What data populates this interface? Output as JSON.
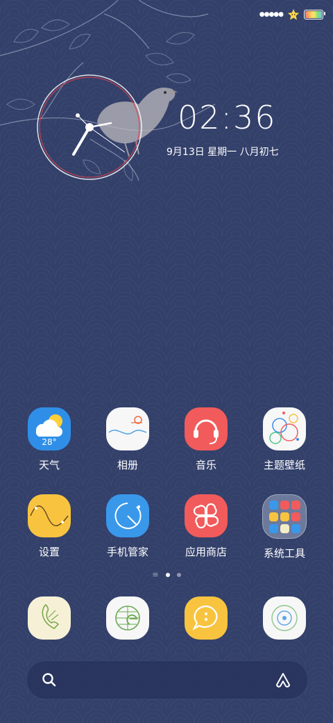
{
  "status_bar": {
    "signal_icon": "signal-dots-icon",
    "star_icon": "star-face-icon",
    "battery_icon": "battery-icon"
  },
  "clock": {
    "time": "02:36",
    "date": "9月13日 星期一 八月初七"
  },
  "apps_row1": [
    {
      "label": "天气",
      "icon": "weather-icon",
      "temp": "28°"
    },
    {
      "label": "相册",
      "icon": "gallery-icon"
    },
    {
      "label": "音乐",
      "icon": "music-icon"
    },
    {
      "label": "主题壁纸",
      "icon": "theme-wallpaper-icon"
    }
  ],
  "apps_row2": [
    {
      "label": "设置",
      "icon": "settings-icon"
    },
    {
      "label": "手机管家",
      "icon": "phone-manager-icon"
    },
    {
      "label": "应用商店",
      "icon": "app-store-icon"
    },
    {
      "label": "系统工具",
      "icon": "system-tools-folder-icon"
    }
  ],
  "dock": [
    {
      "icon": "phone-icon"
    },
    {
      "icon": "browser-icon"
    },
    {
      "icon": "messages-icon"
    },
    {
      "icon": "camera-icon"
    }
  ],
  "search": {
    "search_icon": "search-icon",
    "assistant_icon": "assistant-icon"
  },
  "colors": {
    "background": "#33406a",
    "weather": "#2f8fe8",
    "music": "#f25b5b",
    "settings": "#f8c440",
    "manager": "#3a98ea",
    "store": "#f25b5b",
    "messages": "#f8c440"
  }
}
